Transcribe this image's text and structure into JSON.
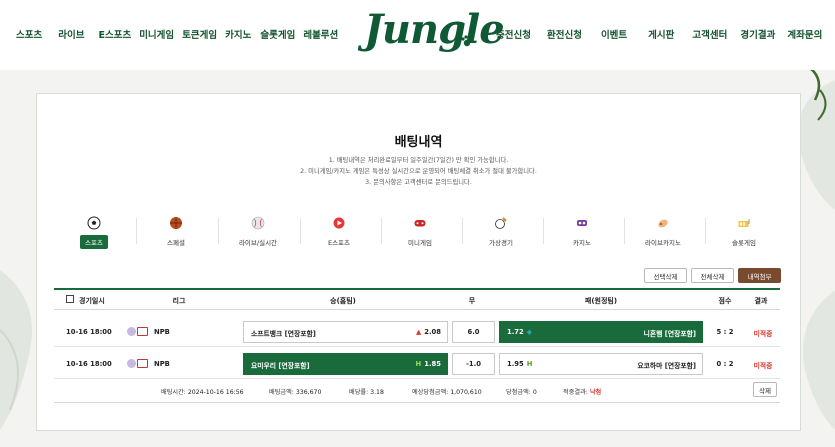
{
  "nav_left": [
    "스포츠",
    "라이브",
    "E스포츠",
    "미니게임",
    "토큰게임",
    "카지노",
    "슬롯게임",
    "레볼루션"
  ],
  "nav_right": [
    "충전신청",
    "환전신청",
    "이벤트",
    "게시판",
    "고객센터",
    "경기결과",
    "계좌문의"
  ],
  "logo": "Jungle",
  "page": {
    "title": "배팅내역",
    "notes": [
      "1. 배팅내역은 처리완료일부터 일주일간(7일간) 만 확인 가능합니다.",
      "2. 미니게임/카지노 게임은 특성상 실시간으로 운영되어 배팅체결 취소가 절대 불가합니다.",
      "3. 문의사항은 고객센터로 문의드립니다."
    ]
  },
  "categories": [
    {
      "label": "스포츠",
      "icon": "soccer-ball-icon",
      "active": true
    },
    {
      "label": "스페셜",
      "icon": "basketball-icon",
      "active": false
    },
    {
      "label": "라이브/실시간",
      "icon": "baseball-icon",
      "active": false
    },
    {
      "label": "E스포츠",
      "icon": "esports-icon",
      "active": false
    },
    {
      "label": "미니게임",
      "icon": "gamepad-icon",
      "active": false
    },
    {
      "label": "가상경기",
      "icon": "virtual-sports-icon",
      "active": false
    },
    {
      "label": "카지노",
      "icon": "casino-icon",
      "active": false
    },
    {
      "label": "라이브카지노",
      "icon": "live-casino-icon",
      "active": false
    },
    {
      "label": "슬롯게임",
      "icon": "slot-icon",
      "active": false
    }
  ],
  "actions": {
    "select_delete": "선택삭제",
    "all_delete": "전체삭제",
    "history_attach": "내역첨부"
  },
  "table": {
    "headers": {
      "datetime": "경기일시",
      "league": "리그",
      "win": "승(홈팀)",
      "draw": "무",
      "lose": "패(원정팀)",
      "score": "점수",
      "result": "결과"
    },
    "rows": [
      {
        "time": "10-16 18:00",
        "league": "NPB",
        "home": "소프트뱅크 [연장포함]",
        "home_odds": "2.08",
        "home_selected": false,
        "draw": "6.0",
        "away_odds": "1.72",
        "away": "니혼햄 [연장포함]",
        "away_selected": true,
        "score": "5 : 2",
        "result": "미적중"
      },
      {
        "time": "10-16 18:00",
        "league": "NPB",
        "home": "요미우리 [연장포함]",
        "home_odds": "1.85",
        "home_selected": true,
        "draw": "-1.0",
        "away_odds": "1.95",
        "away": "요코하마 [연장포함]",
        "away_selected": false,
        "score": "0 : 2",
        "result": "미적중"
      }
    ]
  },
  "summary": {
    "bet_time_label": "배팅시간:",
    "bet_time": "2024-10-16 16:56",
    "bet_amount_label": "배팅금액:",
    "bet_amount": "336,670",
    "odds_label": "배당률:",
    "odds": "3.18",
    "expected_label": "예상당첨금액:",
    "expected": "1,070,610",
    "win_amount_label": "당첨금액:",
    "win_amount": "0",
    "hit_result_label": "적중결과:",
    "hit_result": "낙첨",
    "delete": "삭제"
  },
  "colors": {
    "brand_green": "#1a6b3c",
    "result_red": "#d7372b",
    "attach_brown": "#7a4a2e"
  }
}
